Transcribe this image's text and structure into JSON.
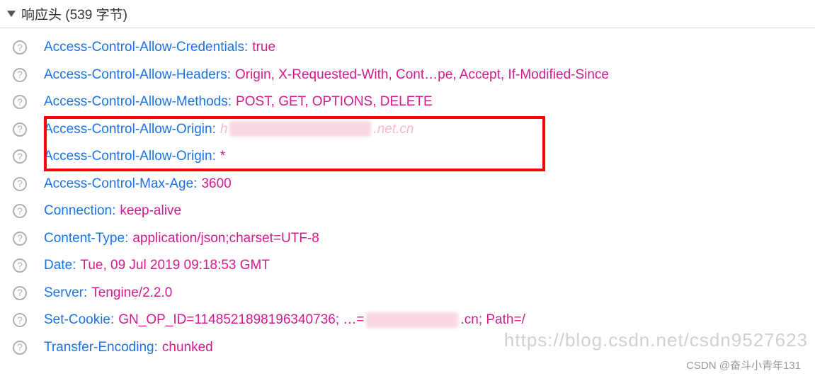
{
  "section": {
    "title": "响应头 (539 字节)"
  },
  "headers": [
    {
      "name": "Access-Control-Allow-Credentials",
      "value": "true"
    },
    {
      "name": "Access-Control-Allow-Headers",
      "value": "Origin, X-Requested-With, Cont…pe, Accept, If-Modified-Since"
    },
    {
      "name": "Access-Control-Allow-Methods",
      "value": "POST, GET, OPTIONS, DELETE"
    },
    {
      "name": "Access-Control-Allow-Origin",
      "value_prefix": "h",
      "value_suffix": ".net.cn",
      "redacted": true
    },
    {
      "name": "Access-Control-Allow-Origin",
      "value": "*"
    },
    {
      "name": "Access-Control-Max-Age",
      "value": "3600"
    },
    {
      "name": "Connection",
      "value": "keep-alive"
    },
    {
      "name": "Content-Type",
      "value": "application/json;charset=UTF-8"
    },
    {
      "name": "Date",
      "value": "Tue, 09 Jul 2019 09:18:53 GMT"
    },
    {
      "name": "Server",
      "value": "Tengine/2.2.0"
    },
    {
      "name": "Set-Cookie",
      "value_prefix": "GN_OP_ID=1148521898196340736; …=",
      "value_suffix": ".cn; Path=/",
      "redacted_sm": true
    },
    {
      "name": "Transfer-Encoding",
      "value": "chunked"
    }
  ],
  "watermark_url": "https://blog.csdn.net/csdn9527623",
  "watermark_credit": "CSDN @奋斗小青年131"
}
